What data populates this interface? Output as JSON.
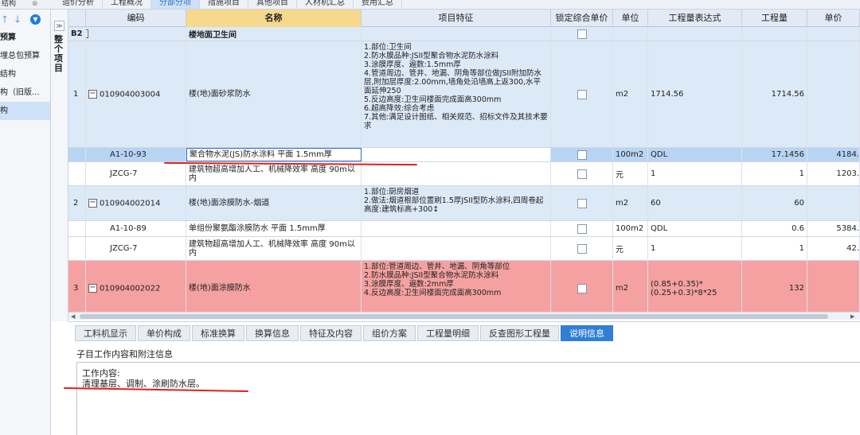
{
  "top_tabs": [
    {
      "label": "造价分析",
      "active": false
    },
    {
      "label": "工程概况",
      "active": false
    },
    {
      "label": "分部分项",
      "active": true
    },
    {
      "label": "措施项目",
      "active": false
    },
    {
      "label": "其他项目",
      "active": false
    },
    {
      "label": "人材机汇总",
      "active": false
    },
    {
      "label": "费用汇总",
      "active": false
    }
  ],
  "left_header": {
    "title": "结构",
    "close": "⊗"
  },
  "left_nav": {
    "items": [
      {
        "label": "预算",
        "bold": true,
        "selected": false
      },
      {
        "label": "埋总包预算",
        "bold": false,
        "selected": false
      },
      {
        "label": "结构",
        "bold": false,
        "selected": false
      },
      {
        "label": "构（旧版...",
        "bold": false,
        "selected": false
      },
      {
        "label": "构",
        "bold": false,
        "selected": true
      }
    ]
  },
  "side_strip": {
    "collapse": "≫",
    "label": "整个项目"
  },
  "columns": [
    "",
    "编码",
    "名称",
    "项目特征",
    "锁定综合单价",
    "单位",
    "工程量表达式",
    "工程量",
    "单价"
  ],
  "group": {
    "code": "B2",
    "toggle": "−",
    "name": "楼地面卫生间"
  },
  "rows": [
    {
      "num": "1",
      "toggle": "−",
      "code": "010904003004",
      "name": "楼(地)面砂浆防水",
      "feature": "1.部位:卫生间\n2.防水膜品种:JSII型聚合物水泥防水涂料\n3.涂膜厚度、遍数:1.5mm厚\n4.管道周边、管井、地漏、阴角等部位做JSII附加防水层,附加层厚度:2.00mm,墙角处沿墙高上返300,水平面延伸250\n5.反边高度:卫生间楼面完成面高300mm\n6.超高降效:综合考虑\n7.其他:满足设计图纸、相关规范、招标文件及其技术要求",
      "unit": "m2",
      "expr": "1714.56",
      "qty": "1714.56",
      "price": ""
    },
    {
      "num": "",
      "toggle": "",
      "code": "A1-10-93",
      "name": "聚合物水泥(JS)防水涂料 平面 1.5mm厚",
      "feature": "",
      "unit": "100m2",
      "expr": "QDL",
      "qty": "17.1456",
      "price": "4184."
    },
    {
      "num": "",
      "toggle": "",
      "code": "JZCG-7",
      "name": "建筑物超高增加人工、机械降效率 高度 90m以内",
      "feature": "",
      "unit": "元",
      "expr": "1",
      "qty": "1",
      "price": "1203."
    },
    {
      "num": "2",
      "toggle": "−",
      "code": "010904002014",
      "name": "楼(地)面涂膜防水-烟道",
      "feature": "1.部位:厨房烟道\n2.做法:烟道根部位置刷1.5厚JSII型防水涂料,四周卷起高度:建筑标高+300↕",
      "unit": "m2",
      "expr": "60",
      "qty": "60",
      "price": ""
    },
    {
      "num": "",
      "toggle": "",
      "code": "A1-10-89",
      "name": "单组份聚氨酯涂膜防水 平面 1.5mm厚",
      "feature": "",
      "unit": "100m2",
      "expr": "QDL",
      "qty": "0.6",
      "price": "5384."
    },
    {
      "num": "",
      "toggle": "",
      "code": "JZCG-7",
      "name": "建筑物超高增加人工、机械降效率 高度 90m以内",
      "feature": "",
      "unit": "元",
      "expr": "1",
      "qty": "1",
      "price": "42."
    },
    {
      "num": "3",
      "toggle": "−",
      "code": "010904002022",
      "name": "楼(地)面涂膜防水",
      "feature": "1.部位:管道周边、管井、地漏、阴角等部位\n2.防水膜品种:JSII型聚合物水泥防水涂料\n3.涂膜厚度、遍数:2mm厚\n4.反边高度:卫生间楼面完成面高300mm",
      "unit": "m2",
      "expr": "(0.85+0.35)*(0.25+0.3)*8*25",
      "qty": "132",
      "price": ""
    }
  ],
  "bottom_tabs": [
    {
      "label": "工料机显示",
      "active": false
    },
    {
      "label": "单价构成",
      "active": false
    },
    {
      "label": "标准换算",
      "active": false
    },
    {
      "label": "换算信息",
      "active": false
    },
    {
      "label": "特征及内容",
      "active": false
    },
    {
      "label": "组价方案",
      "active": false
    },
    {
      "label": "工程量明细",
      "active": false
    },
    {
      "label": "反查图形工程量",
      "active": false
    },
    {
      "label": "说明信息",
      "active": true
    }
  ],
  "bottom_panel": {
    "label": "子目工作内容和附注信息",
    "line1": "工作内容:",
    "line2": "清理基层、调制、涂刷防水层。"
  },
  "colors": {
    "accent": "#2f7fd8",
    "header_active": "#f6d98c",
    "row_blue": "#dce9f7",
    "row_selected": "#b8d4f3",
    "row_red": "#f5a1a1",
    "annotation": "#e02020"
  }
}
